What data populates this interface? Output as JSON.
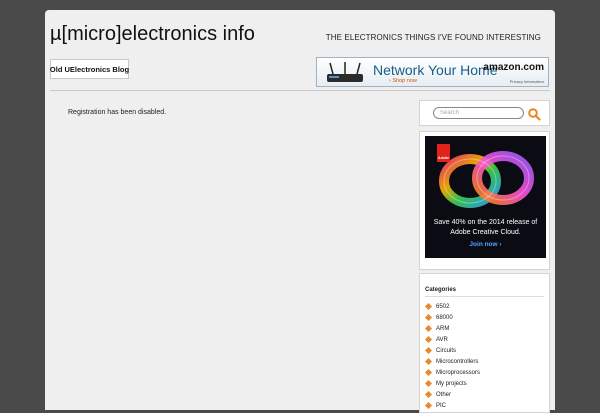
{
  "header": {
    "site_title": "µ[micro]electronics info",
    "tagline": "THE ELECTRONICS THINGS I'VE FOUND INTERESTING"
  },
  "nav": {
    "blog_link": "Old UElectronics Blog"
  },
  "banner": {
    "headline": "Network Your Home",
    "shop_now": "› Shop now",
    "brand": "amazon.com",
    "privacy": "Privacy Information"
  },
  "main": {
    "message": "Registration has been disabled."
  },
  "search": {
    "placeholder": "Search",
    "value": ""
  },
  "ad": {
    "brand": "Adobe",
    "line1": "Save 40% on the 2014 release of",
    "line2": "Adobe Creative Cloud.",
    "cta": "Join now ›"
  },
  "categories": {
    "title": "Categories",
    "items": [
      "6502",
      "68000",
      "ARM",
      "AVR",
      "Circuits",
      "Microcontrollers",
      "Microprocessors",
      "My projects",
      "Other",
      "PIC"
    ]
  },
  "colors": {
    "background": "#4a4a4a",
    "page": "#efefef",
    "search_accent": "#e58a1f",
    "category_icon": "#e8892a"
  }
}
